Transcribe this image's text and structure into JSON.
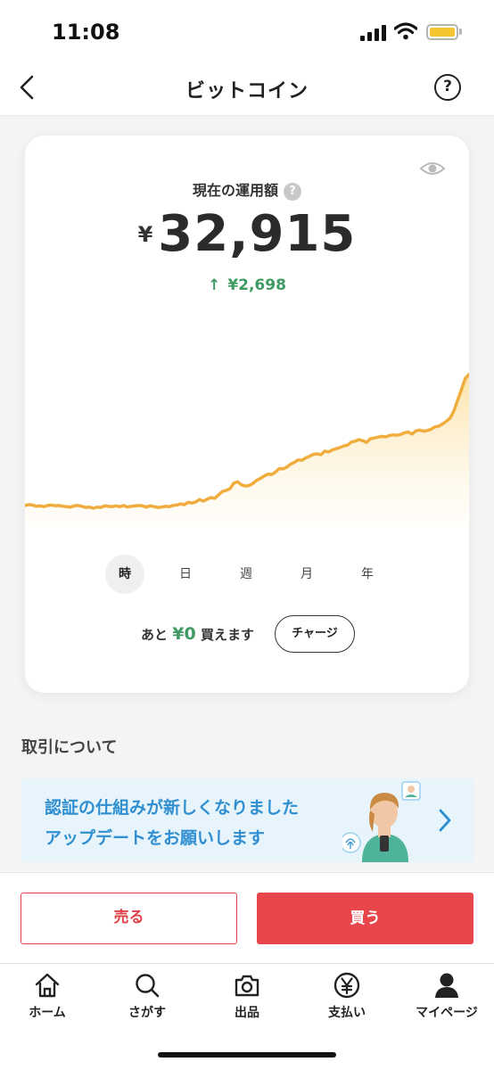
{
  "status_bar": {
    "time": "11:08"
  },
  "header": {
    "title": "ビットコイン",
    "help_label": "?"
  },
  "summary": {
    "label": "現在の運用額",
    "info_label": "?",
    "currency": "¥",
    "amount": "32,915",
    "change_arrow": "↑",
    "change": "¥2,698"
  },
  "chart_data": {
    "type": "area",
    "title": "",
    "xlabel": "",
    "ylabel": "",
    "grid": false,
    "legend": "none",
    "line_color": "#f0ad3e",
    "fill_color": "#fde9b8",
    "y": [
      20,
      22,
      21,
      18,
      19,
      17,
      20,
      21,
      19,
      20,
      18,
      17,
      16,
      19,
      20,
      18,
      15,
      16,
      13,
      16,
      15,
      19,
      18,
      17,
      19,
      17,
      20,
      16,
      18,
      19,
      20,
      19,
      16,
      19,
      17,
      15,
      16,
      18,
      17,
      20,
      21,
      24,
      22,
      28,
      26,
      29,
      35,
      31,
      36,
      40,
      38,
      47,
      55,
      58,
      62,
      76,
      80,
      72,
      69,
      70,
      75,
      83,
      88,
      94,
      99,
      98,
      104,
      113,
      112,
      117,
      124,
      129,
      135,
      134,
      140,
      144,
      149,
      150,
      148,
      157,
      155,
      160,
      163,
      166,
      170,
      172,
      180,
      182,
      186,
      183,
      179,
      188,
      190,
      192,
      194,
      193,
      196,
      198,
      197,
      199,
      203,
      205,
      200,
      208,
      210,
      207,
      209,
      212,
      218,
      220,
      225,
      232,
      240,
      258,
      285,
      312,
      340,
      350
    ]
  },
  "period_tabs": [
    {
      "label": "時",
      "active": true
    },
    {
      "label": "日",
      "active": false
    },
    {
      "label": "週",
      "active": false
    },
    {
      "label": "月",
      "active": false
    },
    {
      "label": "年",
      "active": false
    }
  ],
  "purchase": {
    "prefix": "あと",
    "amount": "¥0",
    "suffix": "買えます",
    "charge_label": "チャージ"
  },
  "section": {
    "title": "取引について"
  },
  "banner": {
    "line1": "認証の仕組みが新しくなりました",
    "line2": "アップデートをお願いします"
  },
  "actions": {
    "sell_label": "売る",
    "buy_label": "買う"
  },
  "tab_bar": [
    {
      "label": "ホーム",
      "icon": "home-icon"
    },
    {
      "label": "さがす",
      "icon": "search-icon"
    },
    {
      "label": "出品",
      "icon": "camera-icon"
    },
    {
      "label": "支払い",
      "icon": "yen-icon"
    },
    {
      "label": "マイページ",
      "icon": "user-icon"
    }
  ],
  "colors": {
    "accent_red": "#e8464b",
    "up_green": "#3f9a63",
    "banner_blue": "#2f8fd0",
    "chart_orange": "#f0ad3e"
  }
}
